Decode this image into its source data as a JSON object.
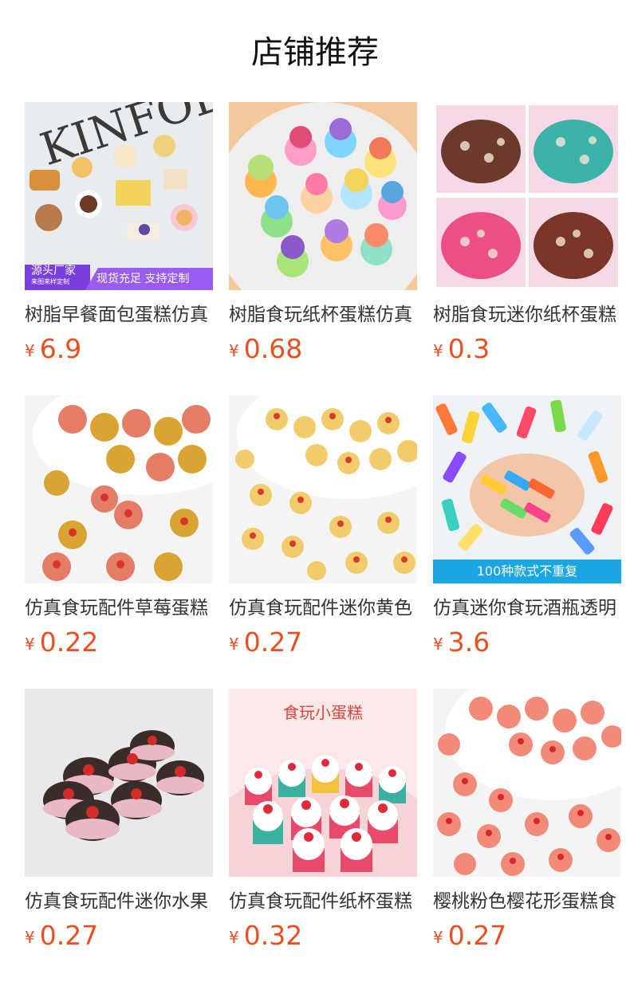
{
  "header": {
    "title": "店铺推荐"
  },
  "colors": {
    "price": "#e8501f",
    "badge_purple": "#7b3fe0",
    "strip_blue": "#1aa6e4",
    "overlay_red": "#e0443c"
  },
  "products": [
    {
      "name": "树脂早餐面包蛋糕仿真",
      "currency": "¥",
      "price": "6.9",
      "badge_left_1": "源头厂家",
      "badge_left_2": "来图来样定制",
      "badge_right": "现货充足 支持定制"
    },
    {
      "name": "树脂食玩纸杯蛋糕仿真",
      "currency": "¥",
      "price": "0.68"
    },
    {
      "name": "树脂食玩迷你纸杯蛋糕",
      "currency": "¥",
      "price": "0.3"
    },
    {
      "name": "仿真食玩配件草莓蛋糕",
      "currency": "¥",
      "price": "0.22"
    },
    {
      "name": "仿真食玩配件迷你黄色",
      "currency": "¥",
      "price": "0.27"
    },
    {
      "name": "仿真迷你食玩酒瓶透明",
      "currency": "¥",
      "price": "3.6",
      "strip": "100种款式不重复"
    },
    {
      "name": "仿真食玩配件迷你水果",
      "currency": "¥",
      "price": "0.27"
    },
    {
      "name": "仿真食玩配件纸杯蛋糕",
      "currency": "¥",
      "price": "0.32",
      "overlay": "食玩小蛋糕"
    },
    {
      "name": "樱桃粉色樱花形蛋糕食",
      "currency": "¥",
      "price": "0.27"
    }
  ]
}
